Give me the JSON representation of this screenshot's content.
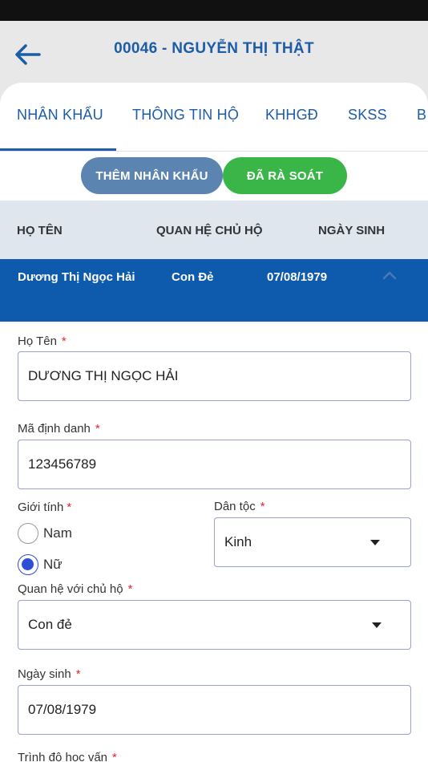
{
  "header": {
    "title": "00046 - NGUYỄN THỊ THẬT"
  },
  "tabs": [
    {
      "label": "NHÂN KHẨU"
    },
    {
      "label": "THÔNG TIN HỘ"
    },
    {
      "label": "KHHGĐ"
    },
    {
      "label": "SKSS"
    },
    {
      "label": "B"
    }
  ],
  "actions": {
    "add_label": "THÊM NHÂN KHẨU",
    "review_label": "ĐÃ RÀ SOÁT"
  },
  "table": {
    "headers": [
      "HỌ TÊN",
      "QUAN HỆ CHỦ HỘ",
      "NGÀY SINH"
    ],
    "row": {
      "name": "Dương Thị Ngọc Hải",
      "relation": "Con Đẻ",
      "dob": "07/08/1979"
    }
  },
  "form": {
    "full_name": {
      "label": "Họ Tên",
      "value": "DƯƠNG THỊ NGỌC HẢI"
    },
    "id_code": {
      "label": "Mã định danh",
      "value": "123456789"
    },
    "gender": {
      "label": "Giới tính",
      "options": [
        "Nam",
        "Nữ"
      ],
      "selected": "Nữ"
    },
    "ethnicity": {
      "label": "Dân tộc",
      "value": "Kinh"
    },
    "relation": {
      "label": "Quan hệ với chủ hộ",
      "value": "Con đẻ"
    },
    "dob": {
      "label": "Ngày sinh",
      "value": "07/08/1979"
    },
    "education": {
      "label": "Trình độ học vấn"
    },
    "required_mark": "*"
  },
  "colors": {
    "primary": "#1d5ca6",
    "row_header": "#0e5aad",
    "add_button": "#5b84b1",
    "review_button": "#3ab649",
    "required": "#e0262a",
    "radio_selected": "#2e4ed8"
  }
}
